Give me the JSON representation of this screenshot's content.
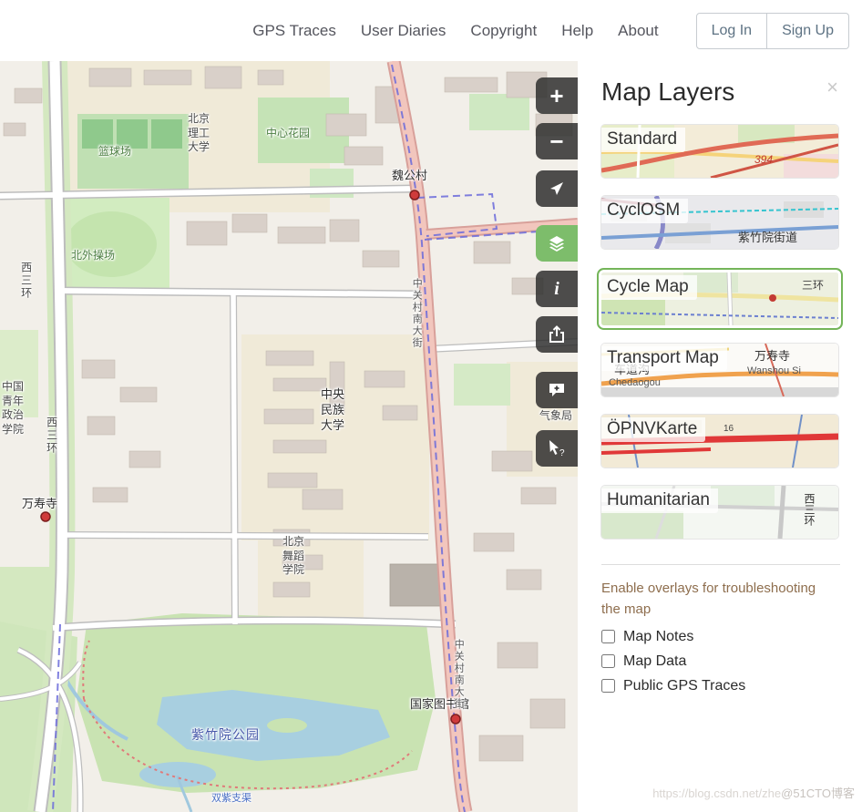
{
  "header": {
    "nav_links": [
      {
        "label": "GPS Traces"
      },
      {
        "label": "User Diaries"
      },
      {
        "label": "Copyright"
      },
      {
        "label": "Help"
      },
      {
        "label": "About"
      }
    ],
    "login_label": "Log In",
    "signup_label": "Sign Up"
  },
  "map": {
    "controls": {
      "zoom_in_glyph": "+",
      "zoom_out_glyph": "−",
      "info_glyph": "i",
      "query_glyph": "?"
    },
    "marker_color": "#cf3b3b",
    "labels": [
      {
        "text": "篮球场"
      },
      {
        "text": "北京\n理工\n大学"
      },
      {
        "text": "中心花园"
      },
      {
        "text": "魏公村"
      },
      {
        "text": "北外操场"
      },
      {
        "text": "西三环"
      },
      {
        "text": "中国\n青年\n政治\n学院"
      },
      {
        "text": "西三环"
      },
      {
        "text": "中央\n民族\n大学"
      },
      {
        "text": "万寿寺"
      },
      {
        "text": "北京\n舞蹈\n学院"
      },
      {
        "text": "国家图书馆"
      },
      {
        "text": "紫竹院公园"
      },
      {
        "text": "中关村南大街"
      },
      {
        "text": "中关村南大街"
      },
      {
        "text": "气象局"
      },
      {
        "text": "双紫支渠"
      }
    ]
  },
  "layers_panel": {
    "title": "Map Layers",
    "close_glyph": "×",
    "layers": [
      {
        "label": "Standard",
        "selected": false,
        "thumb_texts": [
          "394"
        ]
      },
      {
        "label": "CyclOSM",
        "selected": false,
        "thumb_texts": [
          "紫竹院街道"
        ]
      },
      {
        "label": "Cycle Map",
        "selected": true,
        "thumb_texts": [
          "三环"
        ]
      },
      {
        "label": "Transport Map",
        "selected": false,
        "thumb_texts": [
          "万寿寺",
          "Wanshou Si",
          "车道沟",
          "Chedaogou"
        ]
      },
      {
        "label": "ÖPNVKarte",
        "selected": false,
        "thumb_texts": [
          "16"
        ]
      },
      {
        "label": "Humanitarian",
        "selected": false,
        "thumb_texts": [
          "西三环"
        ]
      }
    ],
    "overlays_hint": "Enable overlays for troubleshooting the map",
    "overlay_options": [
      {
        "label": "Map Notes",
        "checked": false
      },
      {
        "label": "Map Data",
        "checked": false
      },
      {
        "label": "Public GPS Traces",
        "checked": false
      }
    ]
  },
  "watermark": {
    "url_text": "https://blog.csdn.net/zhe",
    "site_text": "@51CTO博客"
  }
}
